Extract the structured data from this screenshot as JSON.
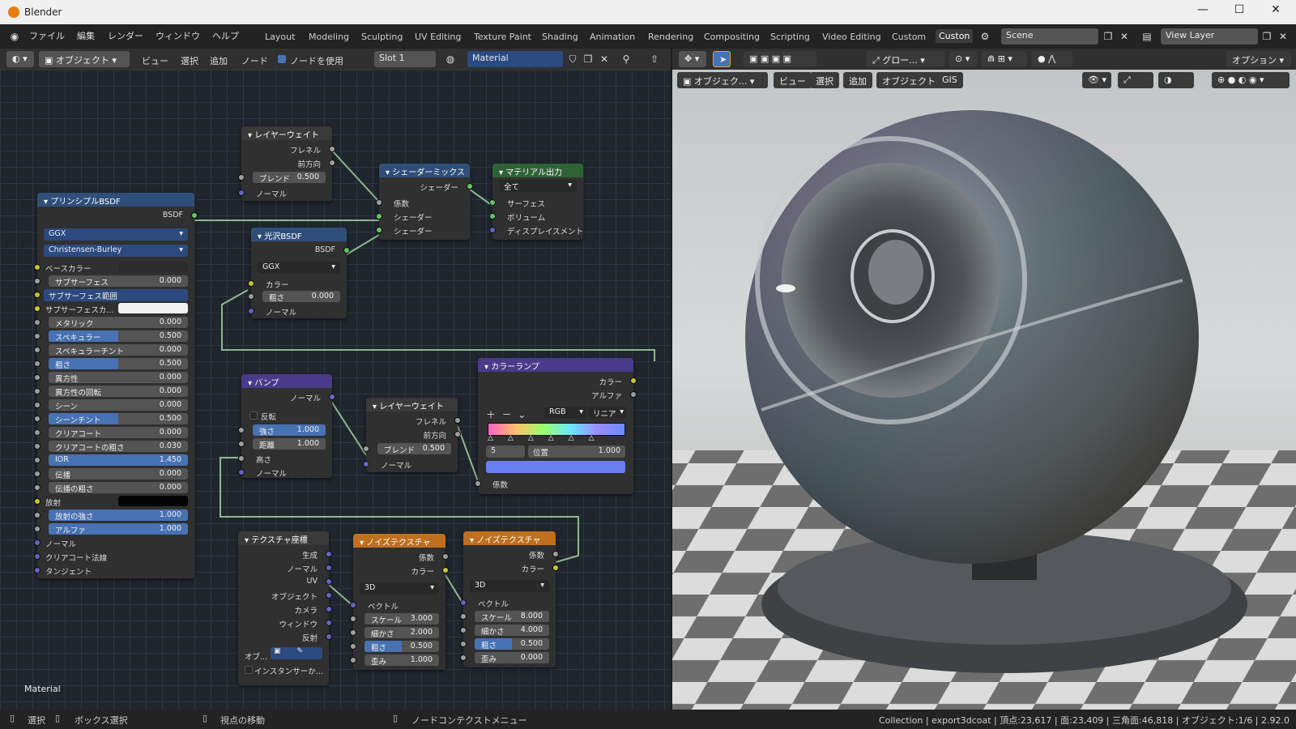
{
  "window": {
    "app_title": "Blender",
    "controls": [
      "—",
      "☐",
      "✕"
    ]
  },
  "menubar": {
    "menus": [
      "ファイル",
      "編集",
      "レンダー",
      "ウィンドウ",
      "ヘルプ"
    ],
    "workspaces": [
      "Layout",
      "Modeling",
      "Sculpting",
      "UV Editing",
      "Texture Paint",
      "Shading",
      "Animation",
      "Rendering",
      "Compositing",
      "Scripting",
      "Video Editing",
      "Custom",
      "Custon"
    ],
    "scene": "Scene",
    "view_layer": "View Layer"
  },
  "node_header": {
    "mode": "オブジェクト",
    "menus": [
      "ビュー",
      "選択",
      "追加",
      "ノード"
    ],
    "use_nodes_label": "ノードを使用",
    "slot": "Slot 1",
    "material": "Material"
  },
  "viewport_header": {
    "global": "グロー...",
    "options": "オプション",
    "mode": "オブジェク...",
    "menus": [
      "ビュー",
      "選択",
      "追加",
      "オブジェクト",
      "GIS"
    ]
  },
  "nodes": {
    "principled": {
      "title": "プリンシプルBSDF",
      "out": "BSDF",
      "dist": "GGX",
      "sss_method": "Christensen-Burley",
      "rows": [
        {
          "label": "ベースカラー",
          "value": "",
          "kind": "color"
        },
        {
          "label": "サブサーフェス",
          "value": "0.000",
          "kind": "num"
        },
        {
          "label": "サブサーフェス範囲",
          "value": "",
          "kind": "dd"
        },
        {
          "label": "サブサーフェスカ...",
          "value": "",
          "kind": "white"
        },
        {
          "label": "メタリック",
          "value": "0.000",
          "kind": "num"
        },
        {
          "label": "スペキュラー",
          "value": "0.500",
          "kind": "fill"
        },
        {
          "label": "スペキュラーチント",
          "value": "0.000",
          "kind": "num"
        },
        {
          "label": "粗さ",
          "value": "0.500",
          "kind": "fill"
        },
        {
          "label": "異方性",
          "value": "0.000",
          "kind": "num"
        },
        {
          "label": "異方性の回転",
          "value": "0.000",
          "kind": "num"
        },
        {
          "label": "シーン",
          "value": "0.000",
          "kind": "num"
        },
        {
          "label": "シーンチント",
          "value": "0.500",
          "kind": "fill"
        },
        {
          "label": "クリアコート",
          "value": "0.000",
          "kind": "num"
        },
        {
          "label": "クリアコートの粗さ",
          "value": "0.030",
          "kind": "num"
        },
        {
          "label": "IOR",
          "value": "1.450",
          "kind": "full"
        },
        {
          "label": "伝播",
          "value": "0.000",
          "kind": "num"
        },
        {
          "label": "伝播の粗さ",
          "value": "0.000",
          "kind": "num"
        },
        {
          "label": "放射",
          "value": "",
          "kind": "black"
        },
        {
          "label": "放射の強さ",
          "value": "1.000",
          "kind": "full"
        },
        {
          "label": "アルファ",
          "value": "1.000",
          "kind": "full"
        },
        {
          "label": "ノーマル",
          "value": "",
          "kind": "vec"
        },
        {
          "label": "クリアコート法線",
          "value": "",
          "kind": "vec"
        },
        {
          "label": "タンジェント",
          "value": "",
          "kind": "vec"
        }
      ]
    },
    "layerweight1": {
      "title": "レイヤーウェイト",
      "fresnel": "フレネル",
      "facing": "前方向",
      "blend_label": "ブレンド",
      "blend": "0.500",
      "normal": "ノーマル"
    },
    "glossy": {
      "title": "光沢BSDF",
      "out": "BSDF",
      "dist": "GGX",
      "color": "カラー",
      "rough_label": "粗さ",
      "rough": "0.000",
      "normal": "ノーマル"
    },
    "mix": {
      "title": "シェーダーミックス",
      "out": "シェーダー",
      "fac": "係数",
      "s1": "シェーダー",
      "s2": "シェーダー"
    },
    "output": {
      "title": "マテリアル出力",
      "target": "全て",
      "surface": "サーフェス",
      "volume": "ボリューム",
      "disp": "ディスプレイスメント"
    },
    "bump": {
      "title": "バンプ",
      "out": "ノーマル",
      "invert": "反転",
      "str_label": "強さ",
      "str": "1.000",
      "dist_label": "距離",
      "dist": "1.000",
      "height": "高さ",
      "normal": "ノーマル"
    },
    "layerweight2": {
      "title": "レイヤーウェイト",
      "fresnel": "フレネル",
      "facing": "前方向",
      "blend_label": "ブレンド",
      "blend": "0.500",
      "normal": "ノーマル"
    },
    "ramp": {
      "title": "カラーランプ",
      "color": "カラー",
      "alpha": "アルファ",
      "mode": "RGB",
      "interp": "リニア",
      "idx": "5",
      "pos_label": "位置",
      "pos": "1.000",
      "fac": "係数"
    },
    "texcoord": {
      "title": "テクスチャ座標",
      "outs": [
        "生成",
        "ノーマル",
        "UV",
        "オブジェクト",
        "カメラ",
        "ウィンドウ",
        "反射"
      ],
      "obj": "オブ...",
      "inst": "インスタンサーか..."
    },
    "noise1": {
      "title": "ノイズテクスチャ",
      "fac": "係数",
      "color": "カラー",
      "dim": "3D",
      "vec": "ベクトル",
      "scale_label": "スケール",
      "scale": "3.000",
      "detail_label": "細かさ",
      "detail": "2.000",
      "rough_label": "粗さ",
      "rough": "0.500",
      "dist_label": "歪み",
      "dist": "1.000"
    },
    "noise2": {
      "title": "ノイズテクスチャ",
      "fac": "係数",
      "color": "カラー",
      "dim": "3D",
      "vec": "ベクトル",
      "scale_label": "スケール",
      "scale": "8.000",
      "detail_label": "細かさ",
      "detail": "4.000",
      "rough_label": "粗さ",
      "rough": "0.500",
      "dist_label": "歪み",
      "dist": "0.000"
    }
  },
  "node_tree_label": "Material",
  "statusbar": {
    "select": "選択",
    "box_select": "ボックス選択",
    "move_view": "視点の移動",
    "context_menu": "ノードコンテクストメニュー",
    "stats": "Collection | export3dcoat | 頂点:23,617 | 面:23,409 | 三角面:46,818 | オブジェクト:1/6 | 2.92.0"
  },
  "colors": {
    "accent": "#4772b3",
    "shader_header": "#2f4f7a",
    "output_header": "#306238",
    "texture_header": "#c06f1e",
    "link": "#8fb88f"
  }
}
